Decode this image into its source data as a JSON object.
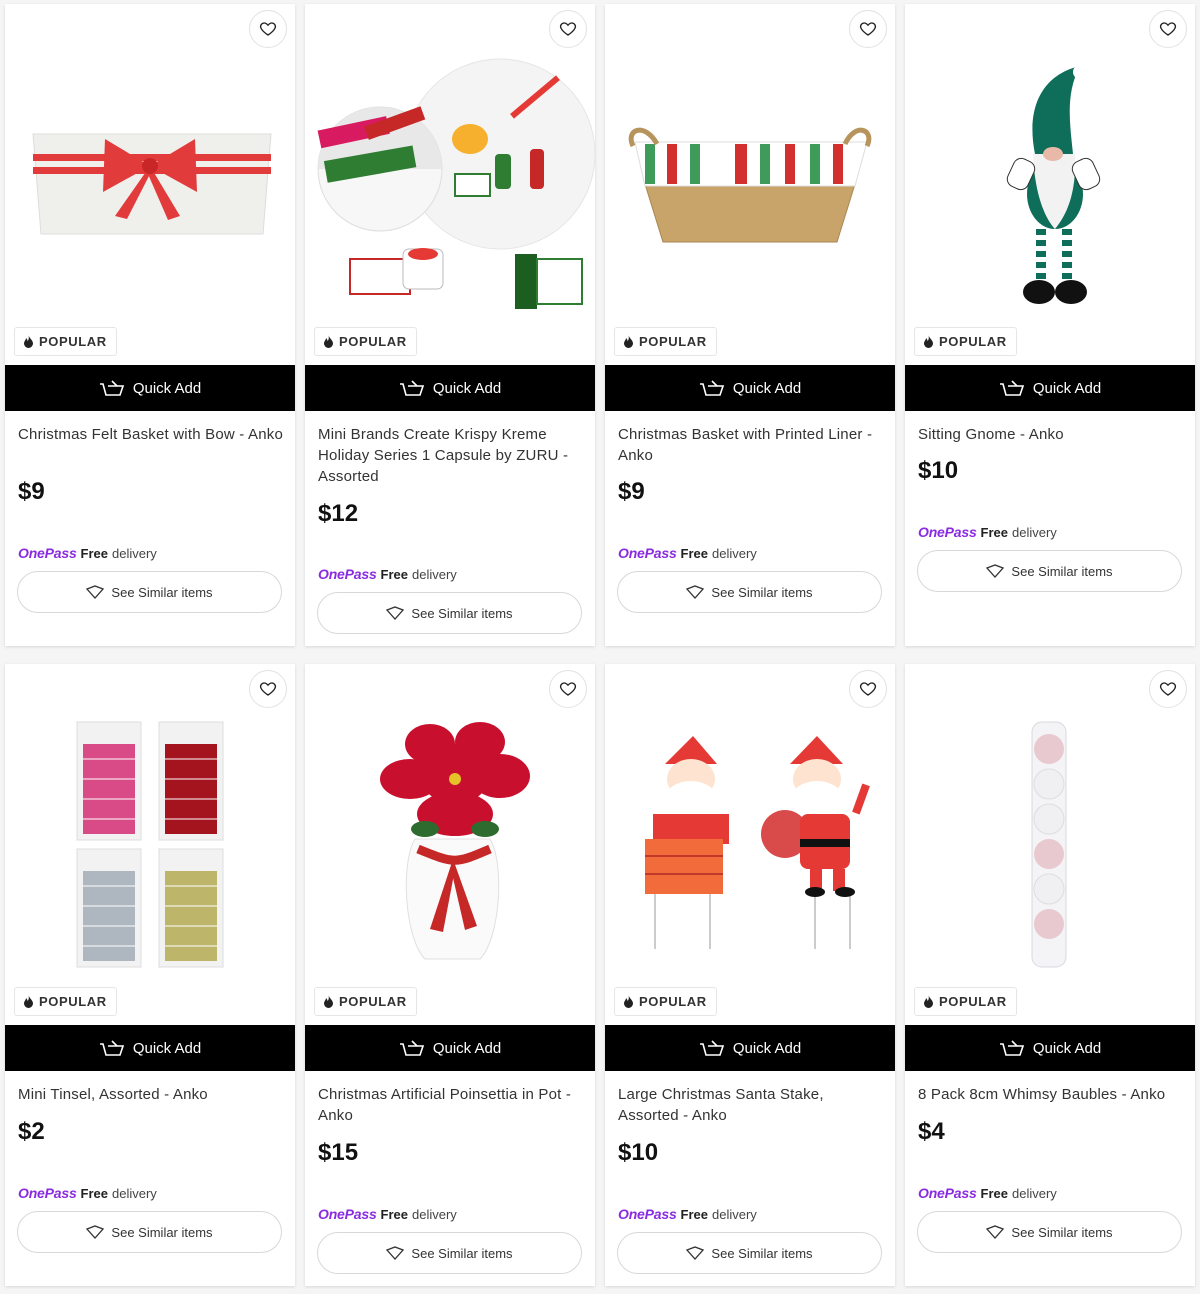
{
  "products": [
    {
      "title": "Christmas Felt Basket with Bow - Anko",
      "price": "$9",
      "badge": "POPULAR"
    },
    {
      "title": "Mini Brands Create Krispy Kreme Holiday Series 1 Capsule by ZURU - Assorted",
      "price": "$12",
      "badge": "POPULAR"
    },
    {
      "title": "Christmas Basket with Printed Liner - Anko",
      "price": "$9",
      "badge": "POPULAR"
    },
    {
      "title": "Sitting Gnome - Anko",
      "price": "$10",
      "badge": "POPULAR"
    },
    {
      "title": "Mini Tinsel, Assorted - Anko",
      "price": "$2",
      "badge": "POPULAR"
    },
    {
      "title": "Christmas Artificial Poinsettia in Pot - Anko",
      "price": "$15",
      "badge": "POPULAR"
    },
    {
      "title": "Large Christmas Santa Stake, Assorted - Anko",
      "price": "$10",
      "badge": "POPULAR"
    },
    {
      "title": "8 Pack 8cm Whimsy Baubles - Anko",
      "price": "$4",
      "badge": "POPULAR"
    }
  ],
  "labels": {
    "quick_add": "Quick Add",
    "onepass": "OnePass",
    "free": "Free",
    "delivery": "delivery",
    "see_similar": "See Similar items"
  },
  "colors": {
    "onepass_purple": "#8a2be2",
    "button_black": "#000000"
  },
  "icons": {
    "wishlist": "heart-icon",
    "badge": "flame-icon",
    "quick_add": "basket-icon",
    "similar": "tag-icon"
  }
}
